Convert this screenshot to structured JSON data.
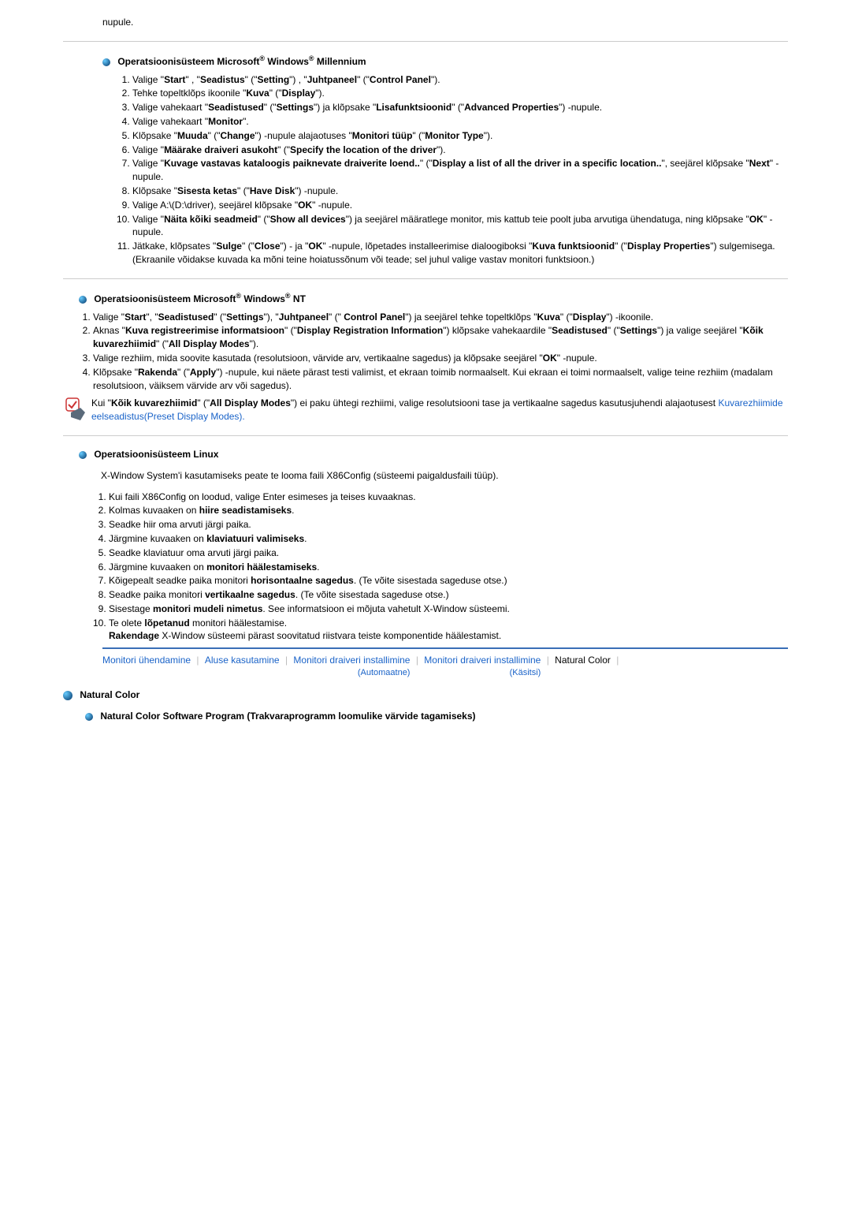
{
  "top_text": "nupule.",
  "sec_me": {
    "title_pre": "Operatsioonisüsteem Microsoft",
    "title_mid": " Windows",
    "title_post": " Millennium",
    "items": [
      "Valige \"<b>Start</b>\" , \"<b>Seadistus</b>\" (\"<b>Setting</b>\") , \"<b>Juhtpaneel</b>\" (\"<b>Control Panel</b>\").",
      "Tehke topeltklõps ikoonile \"<b>Kuva</b>\" (\"<b>Display</b>\").",
      "Valige vahekaart \"<b>Seadistused</b>\" (\"<b>Settings</b>\") ja klõpsake \"<b>Lisafunktsioonid</b>\" (\"<b>Advanced Properties</b>\") -nupule.",
      "Valige vahekaart \"<b>Monitor</b>\".",
      "Klõpsake \"<b>Muuda</b>\" (\"<b>Change</b>\") -nupule alajaotuses \"<b>Monitori tüüp</b>\" (\"<b>Monitor Type</b>\").",
      "Valige \"<b>Määrake draiveri asukoht</b>\" (\"<b>Specify the location of the driver</b>\").",
      "Valige \"<b>Kuvage vastavas kataloogis paiknevate draiverite loend..</b>\" (\"<b>Display a list of all the driver in a specific location..</b>\", seejärel klõpsake \"<b>Next</b>\" -nupule.",
      "Klõpsake \"<b>Sisesta ketas</b>\" (\"<b>Have Disk</b>\") -nupule.",
      "Valige A:\\(D:\\driver), seejärel klõpsake \"<b>OK</b>\" -nupule.",
      "Valige \"<b>Näita kõiki seadmeid</b>\" (\"<b>Show all devices</b>\") ja seejärel määratlege monitor, mis kattub teie poolt juba arvutiga ühendatuga, ning klõpsake \"<b>OK</b>\" -nupule.",
      "Jätkake, klõpsates \"<b>Sulge</b>\" (\"<b>Close</b>\") - ja \"<b>OK</b>\" -nupule, lõpetades installeerimise dialoogiboksi \"<b>Kuva funktsioonid</b>\" (\"<b>Display Properties</b>\") sulgemisega.<br>(Ekraanile võidakse kuvada ka mõni teine hoiatussõnum või teade; sel juhul valige vastav monitori funktsioon.)"
    ]
  },
  "sec_nt": {
    "title_pre": "Operatsioonisüsteem Microsoft",
    "title_mid": " Windows",
    "title_post": " NT",
    "items": [
      "Valige \"<b>Start</b>\", \"<b>Seadistused</b>\" (\"<b>Settings</b>\"), \"<b>Juhtpaneel</b>\" (\" <b>Control Panel</b>\") ja seejärel tehke topeltklõps \"<b>Kuva</b>\" (\"<b>Display</b>\") -ikoonile.",
      "Aknas \"<b>Kuva registreerimise informatsioon</b>\" (\"<b>Display Registration Information</b>\") klõpsake vahekaardile \"<b>Seadistused</b>\" (\"<b>Settings</b>\") ja valige seejärel \"<b>Kõik kuvarezhiimid</b>\" (\"<b>All Display Modes</b>\").",
      "Valige rezhiim, mida soovite kasutada (resolutsioon, värvide arv, vertikaalne sagedus) ja klõpsake seejärel \"<b>OK</b>\" -nupule.",
      "Klõpsake \"<b>Rakenda</b>\" (\"<b>Apply</b>\") -nupule, kui näete pärast testi valimist, et ekraan toimib normaalselt. Kui ekraan ei toimi normaalselt, valige teine rezhiim (madalam resolutsioon, väiksem värvide arv või sagedus)."
    ],
    "note": "Kui \"<b>Kõik kuvarezhiimid</b>\" (\"<b>All Display Modes</b>\") ei paku ühtegi rezhiimi, valige resolutsiooni tase ja vertikaalne sagedus kasutusjuhendi alajaotusest ",
    "note_link": "Kuvarezhiimide eelseadistus(Preset Display Modes)",
    "note_end": "."
  },
  "sec_linux": {
    "title": "Operatsioonisüsteem Linux",
    "intro": "X-Window System'i kasutamiseks peate te looma faili X86Config (süsteemi paigaldusfaili tüüp).",
    "items": [
      "Kui faili X86Config on loodud, valige Enter esimeses ja teises kuvaaknas.",
      "Kolmas kuvaaken on <b>hiire seadistamiseks</b>.",
      "Seadke hiir oma arvuti järgi paika.",
      "Järgmine kuvaaken on <b>klaviatuuri valimiseks</b>.",
      "Seadke klaviatuur oma arvuti järgi paika.",
      "Järgmine kuvaaken on <b>monitori häälestamiseks</b>.",
      "Kõigepealt seadke paika monitori <b>horisontaalne sagedus</b>. (Te võite sisestada sageduse otse.)",
      "Seadke paika monitori <b>vertikaalne sagedus</b>. (Te võite sisestada sageduse otse.)",
      "Sisestage <b>monitori mudeli nimetus</b>. See informatsioon ei mõjuta vahetult X-Window süsteemi.",
      "Te olete <b>lõpetanud</b> monitori häälestamise.<br><b>Rakendage</b> X-Window süsteemi pärast soovitatud riistvara teiste komponentide häälestamist."
    ]
  },
  "nav": {
    "n1": "Monitori ühendamine",
    "n2": "Aluse kasutamine",
    "n3": "Monitori draiveri installimine",
    "n3s": "(Automaatne)",
    "n4": "Monitori draiveri installimine",
    "n4s": "(Käsitsi)",
    "n5": "Natural Color"
  },
  "nc": {
    "head": "Natural Color",
    "sub": "Natural Color Software Program (Trakvaraprogramm loomulike värvide tagamiseks)"
  }
}
